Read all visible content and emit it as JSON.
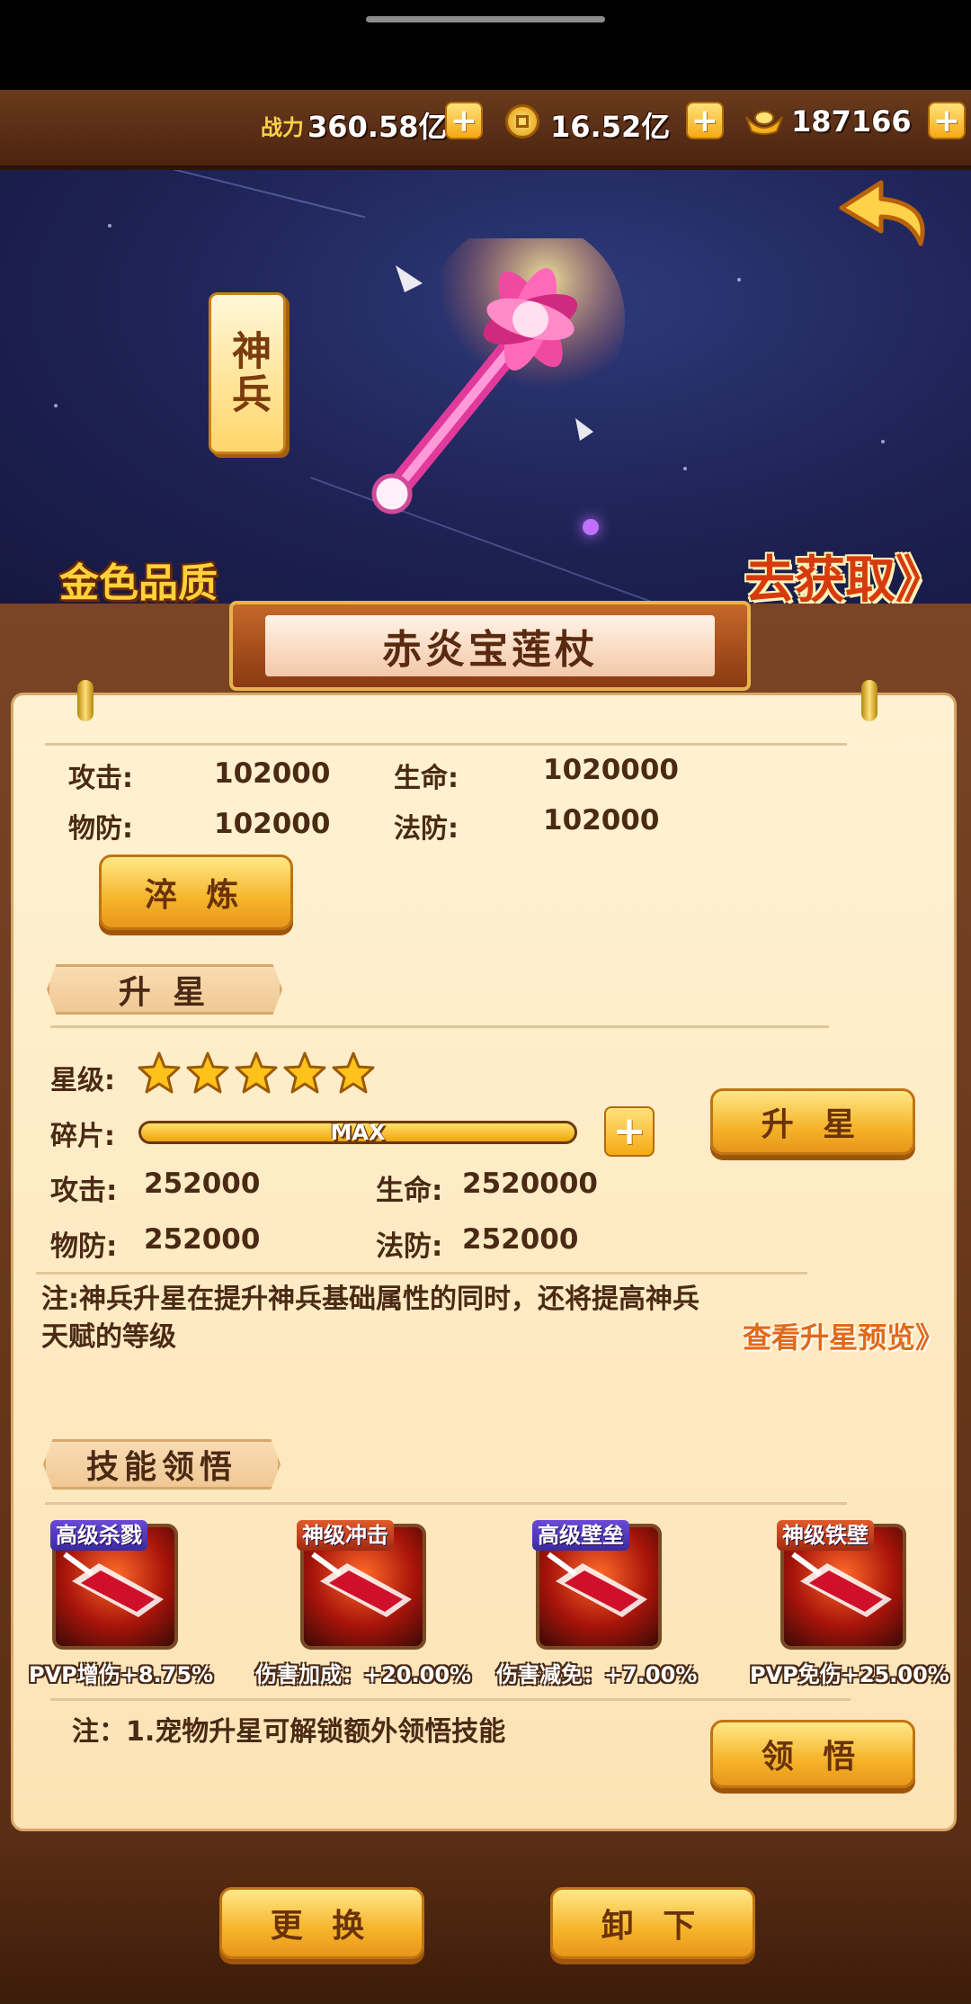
{
  "resources": {
    "power_label": "战力",
    "power_value": "360.58亿",
    "gold_value": "16.52亿",
    "ingot_value": "187166"
  },
  "hero": {
    "category": "神兵",
    "quality": "金色品质",
    "obtain_link": "去获取》"
  },
  "item": {
    "name": "赤炎宝莲杖",
    "stats": [
      {
        "label": "攻击:",
        "value": "102000"
      },
      {
        "label": "生命:",
        "value": "1020000"
      },
      {
        "label": "物防:",
        "value": "102000"
      },
      {
        "label": "法防:",
        "value": "102000"
      }
    ],
    "refine_label": "淬 炼"
  },
  "star_up": {
    "section_title": "升 星",
    "star_label": "星级:",
    "stars": 5,
    "shard_label": "碎片:",
    "shard_status": "MAX",
    "shard_progress": 1.0,
    "button_label": "升 星",
    "stats": [
      {
        "label": "攻击:",
        "value": "252000"
      },
      {
        "label": "生命:",
        "value": "2520000"
      },
      {
        "label": "物防:",
        "value": "252000"
      },
      {
        "label": "法防:",
        "value": "252000"
      }
    ],
    "note": "注:神兵升星在提升神兵基础属性的同时，还将提高神兵天赋的等级",
    "preview_link": "查看升星预览》"
  },
  "skills": {
    "section_title": "技能领悟",
    "items": [
      {
        "name": "高级杀戮",
        "desc": "PVP增伤+8.75%",
        "tag_color": "#3a2aa0"
      },
      {
        "name": "神级冲击",
        "desc": "伤害加成：+20.00%",
        "tag_color": "#c03a14"
      },
      {
        "name": "高级壁垒",
        "desc": "伤害减免：+7.00%",
        "tag_color": "#3a2aa0"
      },
      {
        "name": "神级铁壁",
        "desc": "PVP免伤+25.00%",
        "tag_color": "#c03a14"
      }
    ],
    "note": "注：1.宠物升星可解锁额外领悟技能",
    "button_label": "领 悟"
  },
  "footer": {
    "replace_label": "更 换",
    "unequip_label": "卸 下"
  },
  "icons": [
    "home-handle",
    "gold-coin-icon",
    "ingot-icon",
    "plus-icon",
    "back-arrow-icon",
    "weapon-staff-icon",
    "star-icon",
    "skill-icon"
  ]
}
